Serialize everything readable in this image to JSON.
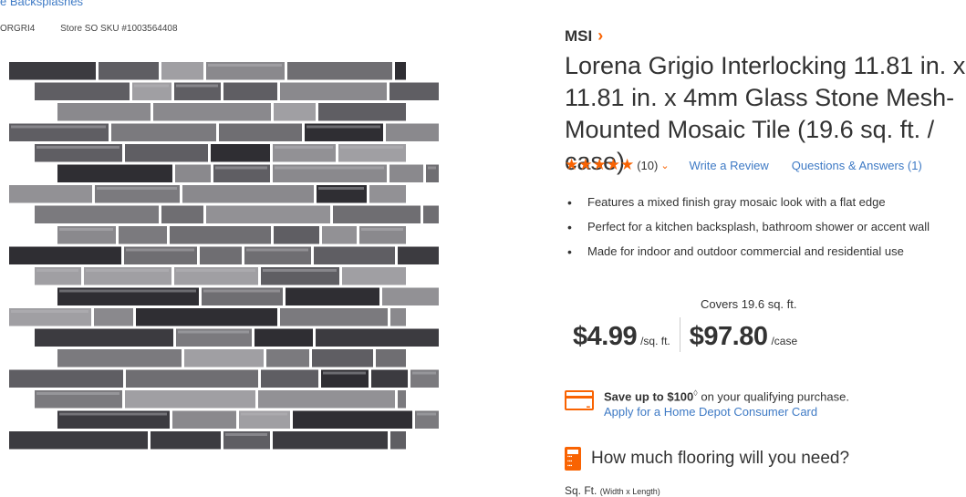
{
  "breadcrumb": {
    "text": "e Backsplashes"
  },
  "ids": {
    "model": "ORGRI4",
    "store_sku": "Store SO SKU #1003564408"
  },
  "product": {
    "brand": "MSI",
    "title": "Lorena Grigio Interlocking 11.81 in. x 11.81 in. x 4mm Glass Stone Mesh-Mounted Mosaic Tile (19.6 sq. ft. / case)",
    "rating": {
      "stars": "★★★★★",
      "count": "(10)",
      "write_review": "Write a Review",
      "questions": "Questions & Answers (1)"
    },
    "bullets": [
      "Features a mixed finish gray mosaic look with a flat edge",
      "Perfect for a kitchen backsplash, bathroom shower or accent wall",
      "Made for indoor and outdoor commercial and residential use"
    ],
    "covers": "Covers 19.6 sq. ft.",
    "price_sqft": "$4.99",
    "price_sqft_unit": "/sq. ft.",
    "price_case": "$97.80",
    "price_case_unit": "/case"
  },
  "promo": {
    "save_bold": "Save up to $100",
    "save_mark": "◊",
    "save_rest": " on your qualifying purchase.",
    "apply_link": "Apply for a Home Depot Consumer Card"
  },
  "calculator": {
    "title": "How much flooring will you need?",
    "label": "Sq. Ft.",
    "sub": "(Width x Length)"
  },
  "icons": {
    "brand_chevron": "chevron-right-icon",
    "rating_caret": "chevron-down-icon",
    "card": "credit-card-icon",
    "calc": "calculator-icon"
  },
  "colors": {
    "accent": "#f96302",
    "link": "#3e7ac5",
    "text": "#333333"
  }
}
